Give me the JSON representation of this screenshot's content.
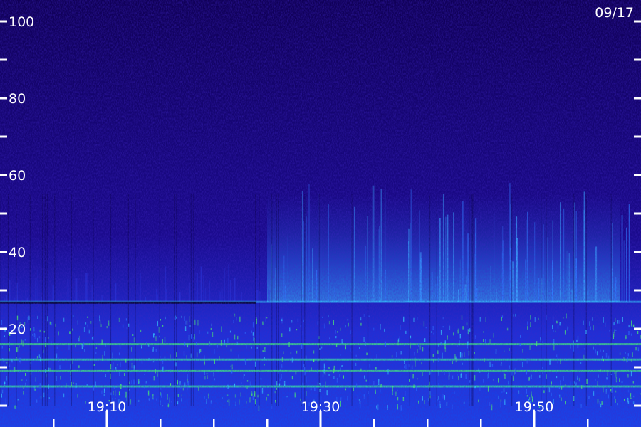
{
  "date_label": "09/17",
  "colors": {
    "background": "#14006a",
    "low": "#2a10c8",
    "mid": "#1e5cff",
    "high": "#3ad0ff",
    "peak": "#4dff6a",
    "tick": "#ffffff"
  },
  "chart_data": {
    "type": "heatmap",
    "title": "",
    "xlabel": "",
    "ylabel": "",
    "ylim": [
      0,
      100
    ],
    "y_ticks": [
      {
        "value": 100,
        "label": "100"
      },
      {
        "value": 80,
        "label": "80"
      },
      {
        "value": 60,
        "label": "60"
      },
      {
        "value": 40,
        "label": "40"
      },
      {
        "value": 20,
        "label": "20"
      }
    ],
    "y_minor_ticks": [
      0,
      10,
      30,
      50,
      70,
      90
    ],
    "x_ticks": [
      {
        "time": "19:10",
        "label": "19:10"
      },
      {
        "time": "19:30",
        "label": "19:30"
      },
      {
        "time": "19:50",
        "label": "19:50"
      }
    ],
    "xlim": [
      "19:00",
      "20:00"
    ],
    "x_minor_tick_interval_min": 5,
    "features": [
      {
        "name": "continuous band",
        "y": 27
      },
      {
        "name": "continuous band",
        "y": 16
      },
      {
        "name": "continuous band",
        "y": 12
      },
      {
        "name": "continuous band",
        "y": 9
      },
      {
        "name": "continuous band",
        "y": 5
      }
    ]
  }
}
